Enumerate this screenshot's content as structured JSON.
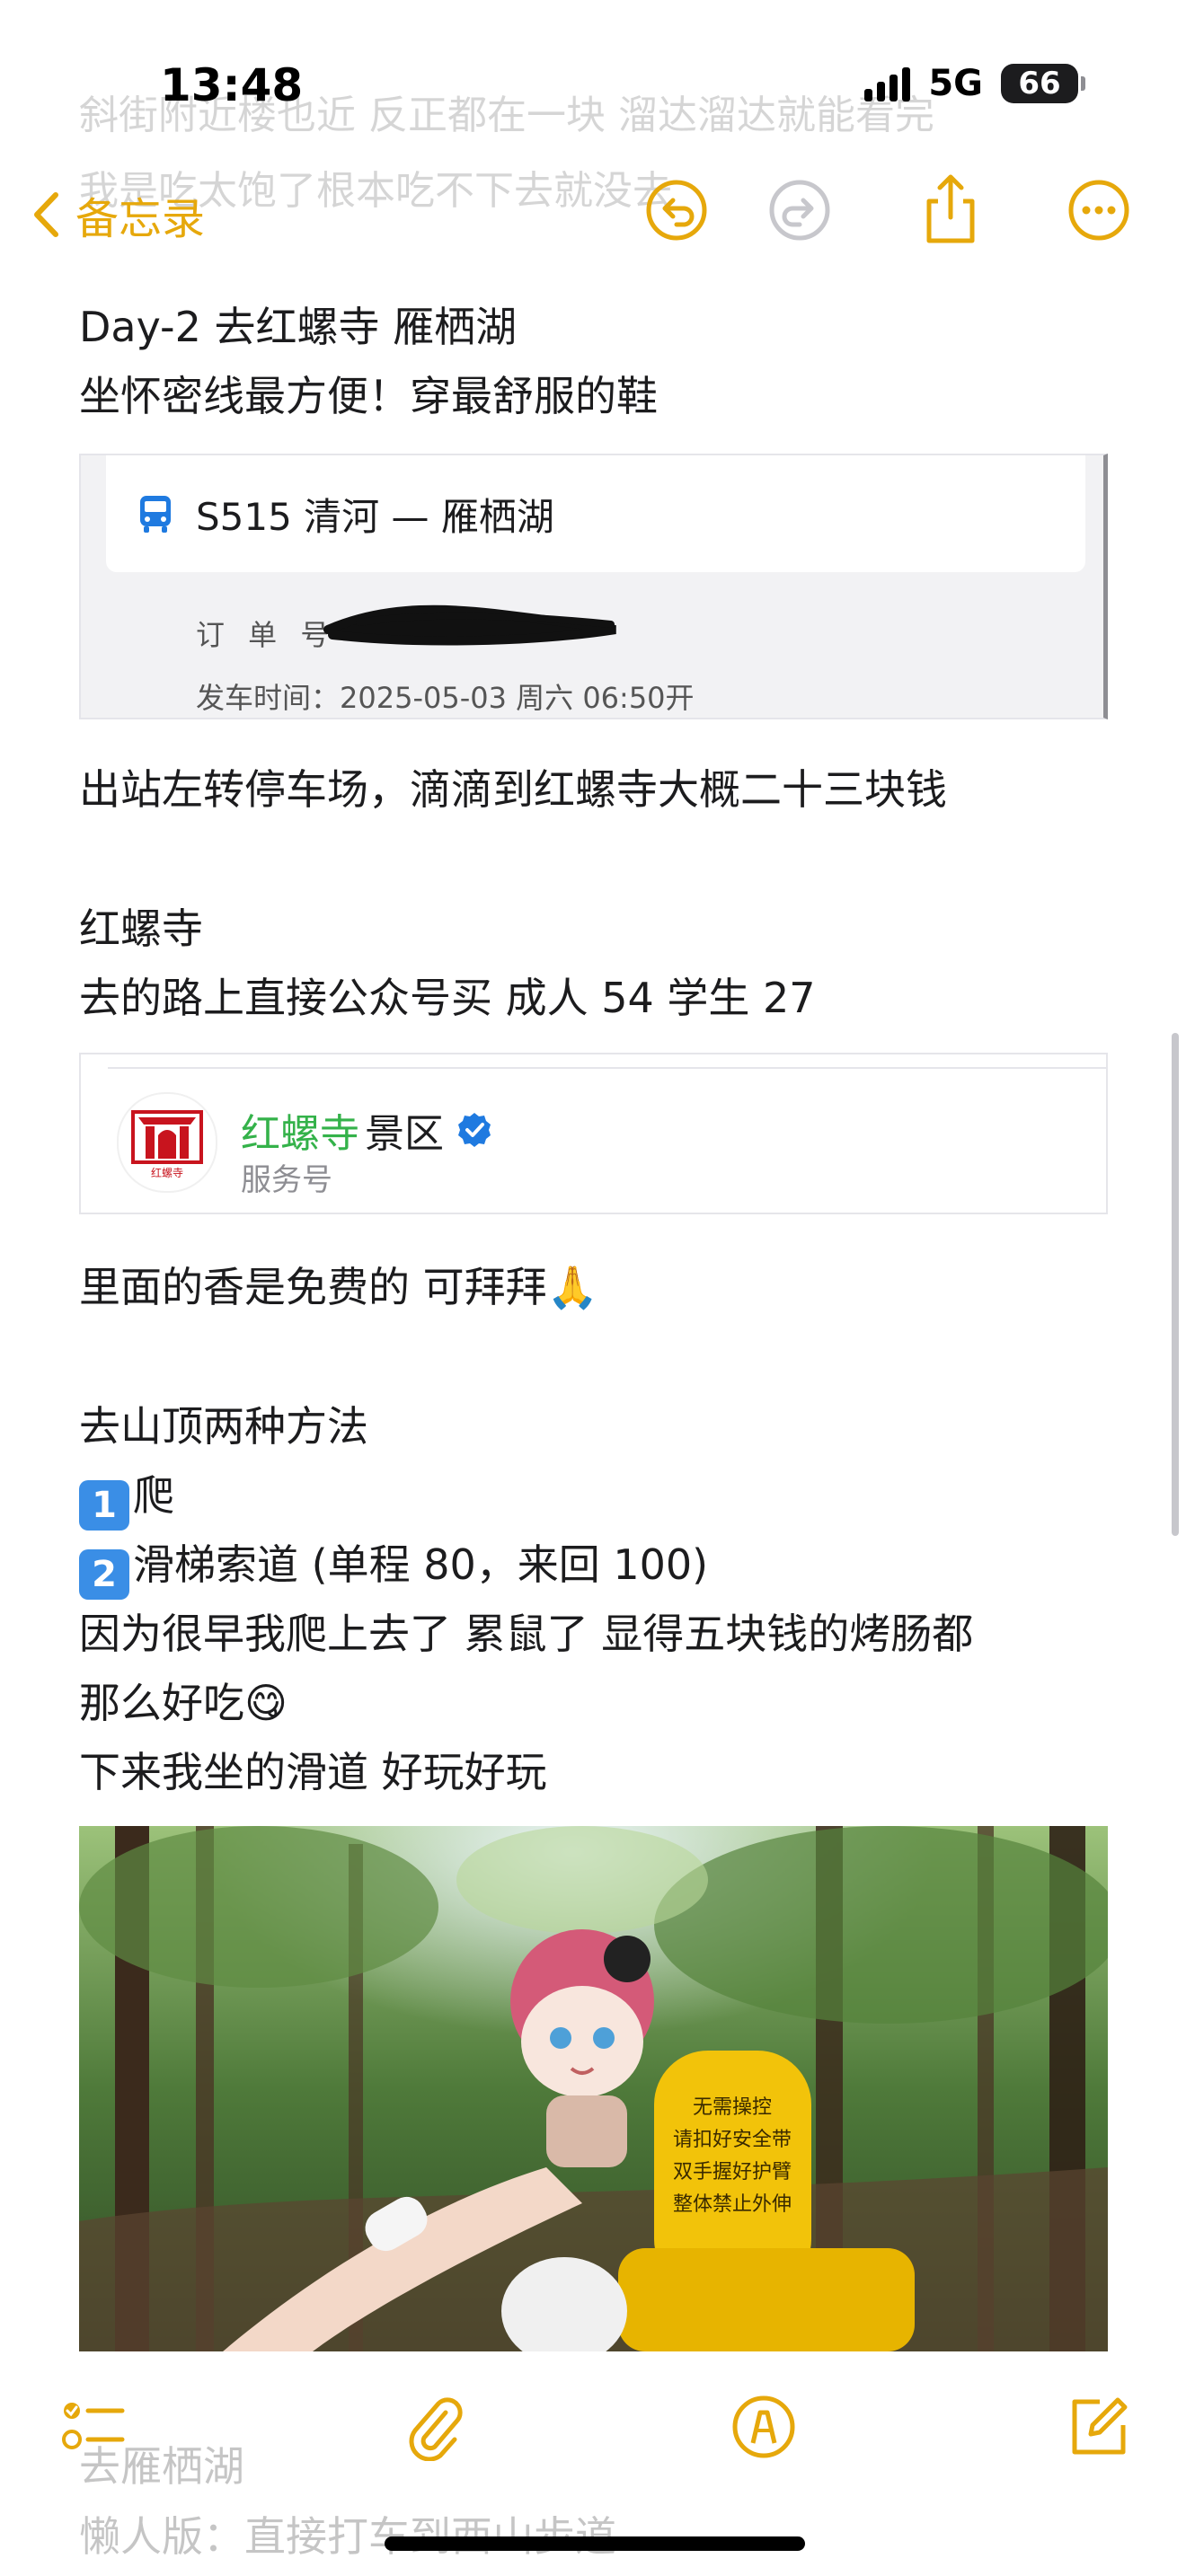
{
  "status": {
    "time": "13:48",
    "network": "5G",
    "battery": "66"
  },
  "nav": {
    "back_label": "备忘录"
  },
  "ghost_top": {
    "line1": "斜街附近楼也近 反正都在一块 溜达溜达就能看完",
    "line2": "我是吃太饱了根本吃不下去就没去"
  },
  "note": {
    "day_title": "Day-2 去红螺寺 雁栖湖",
    "tip": "坐怀密线最方便！穿最舒服的鞋",
    "after_station": "出站左转停车场，滴滴到红螺寺大概二十三块钱",
    "temple_heading": "红螺寺",
    "ticket_info": "去的路上直接公众号买 成人 54 学生 27",
    "incense": "里面的香是免费的  可拜拜🙏",
    "summit_heading": "去山顶两种方法",
    "method1_num": "1",
    "method1": "爬",
    "method2_num": "2",
    "method2": "滑梯索道 (单程 80，来回 100)",
    "climb1": "因为很早我爬上去了 累鼠了 显得五块钱的烤肠都",
    "climb2": "那么好吃😋",
    "slide": "下来我坐的滑道 好玩好玩"
  },
  "ticket": {
    "route": "S515  清河 — 雁栖湖",
    "order_label": "订 单 号",
    "depart": "发车时间：2025-05-03  周六  06:50开"
  },
  "service": {
    "name_highlight": "红螺寺",
    "name_rest": "景区",
    "type": "服务号",
    "logo_text": "红螺寺"
  },
  "photo": {
    "sign_lines": [
      "无需操控",
      "请扣好安全带",
      "双手握好护臂",
      "整体禁止外伸"
    ]
  },
  "bottom_ghost": {
    "line1": "去雁栖湖",
    "line2": "懒人版：直接打车到西山步道"
  },
  "colors": {
    "accent": "#e6a80b",
    "disabled": "#c7c7cc",
    "verified": "#1f7ae0",
    "highlight_green": "#34b24a"
  }
}
